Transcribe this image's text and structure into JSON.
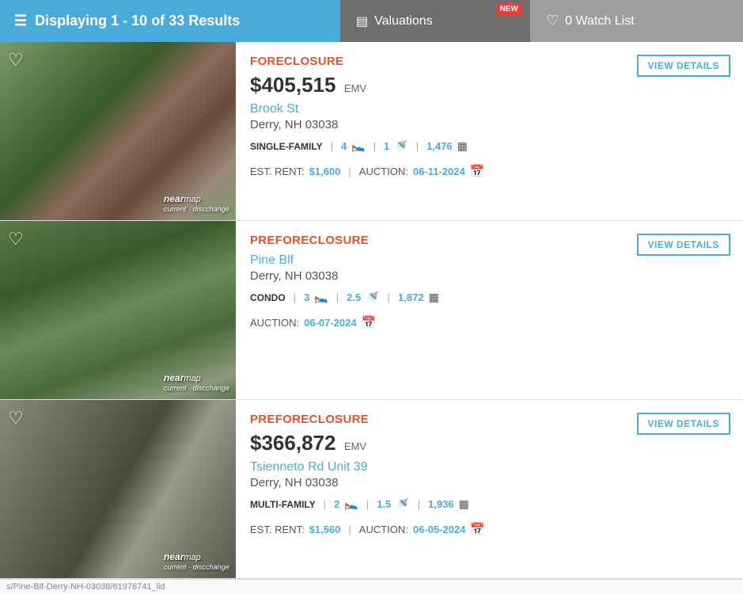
{
  "header": {
    "results_text": "Displaying 1 - 10 of 33 Results",
    "valuations_label": "Valuations",
    "new_badge": "NEW",
    "watchlist_count": "0",
    "watchlist_label": "Watch List"
  },
  "listings": [
    {
      "id": "listing-1",
      "type": "FORECLOSURE",
      "price": "$405,515",
      "emv": "EMV",
      "address_line1": "Brook St",
      "address_line2": "Derry, NH 03038",
      "prop_type": "SINGLE-FAMILY",
      "beds": "4",
      "baths": "1",
      "sqft": "1,476",
      "est_rent_label": "EST. RENT:",
      "est_rent": "$1,600",
      "auction_label": "AUCTION:",
      "auction_date": "06-11-2024",
      "view_details": "VIEW DETAILS",
      "img_class": "img-1",
      "has_price": true,
      "has_est_rent": true
    },
    {
      "id": "listing-2",
      "type": "PREFORECLOSURE",
      "price": null,
      "emv": null,
      "address_line1": "Pine Blf",
      "address_line2": "Derry, NH 03038",
      "prop_type": "CONDO",
      "beds": "3",
      "baths": "2.5",
      "sqft": "1,872",
      "est_rent_label": "",
      "est_rent": null,
      "auction_label": "AUCTION:",
      "auction_date": "06-07-2024",
      "view_details": "VIEW DETAILS",
      "img_class": "img-2",
      "has_price": false,
      "has_est_rent": false
    },
    {
      "id": "listing-3",
      "type": "PREFORECLOSURE",
      "price": "$366,872",
      "emv": "EMV",
      "address_line1": "Tsienneto Rd Unit 39",
      "address_line2": "Derry, NH 03038",
      "prop_type": "MULTI-FAMILY",
      "beds": "2",
      "baths": "1.5",
      "sqft": "1,936",
      "est_rent_label": "EST. RENT:",
      "est_rent": "$1,560",
      "auction_label": "AUCTION:",
      "auction_date": "06-05-2024",
      "view_details": "VIEW DETAILS",
      "img_class": "img-3",
      "has_price": true,
      "has_est_rent": true
    }
  ],
  "url_bar": "s/Pine-Blf-Derry-NH-03038/61976741_lid"
}
